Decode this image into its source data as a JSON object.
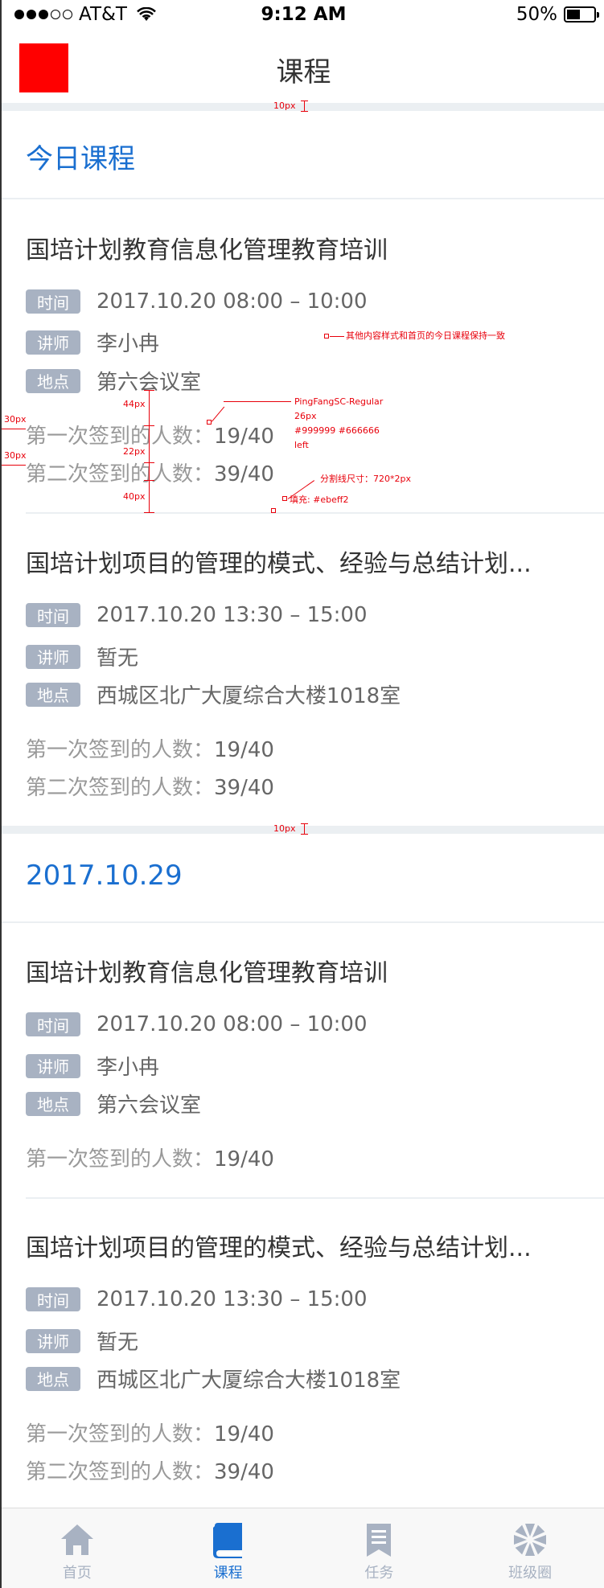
{
  "status_bar": {
    "carrier": "AT&T",
    "time": "9:12 AM",
    "battery": "50%",
    "battery_level": 0.5
  },
  "nav": {
    "title": "课程"
  },
  "sections": [
    {
      "title": "今日课程",
      "courses": [
        {
          "title": "国培计划教育信息化管理教育培训",
          "time_tag": "时间",
          "time": "2017.10.20 08:00 – 10:00",
          "teacher_tag": "讲师",
          "teacher": "李小冉",
          "location_tag": "地点",
          "location": "第六会议室",
          "counts": [
            {
              "label": "第一次签到的人数：",
              "value": "19/40"
            },
            {
              "label": "第二次签到的人数：",
              "value": "39/40"
            }
          ]
        },
        {
          "title": "国培计划项目的管理的模式、经验与总结计划...",
          "time_tag": "时间",
          "time": "2017.10.20 13:30 – 15:00",
          "teacher_tag": "讲师",
          "teacher": "暂无",
          "location_tag": "地点",
          "location": "西城区北广大厦综合大楼1018室",
          "counts": [
            {
              "label": "第一次签到的人数：",
              "value": "19/40"
            },
            {
              "label": "第二次签到的人数：",
              "value": "39/40"
            }
          ]
        }
      ]
    },
    {
      "title": "2017.10.29",
      "courses": [
        {
          "title": "国培计划教育信息化管理教育培训",
          "time_tag": "时间",
          "time": "2017.10.20 08:00 – 10:00",
          "teacher_tag": "讲师",
          "teacher": "李小冉",
          "location_tag": "地点",
          "location": "第六会议室",
          "counts": [
            {
              "label": "第一次签到的人数：",
              "value": "19/40"
            }
          ]
        },
        {
          "title": "国培计划项目的管理的模式、经验与总结计划...",
          "time_tag": "时间",
          "time": "2017.10.20 13:30 – 15:00",
          "teacher_tag": "讲师",
          "teacher": "暂无",
          "location_tag": "地点",
          "location": "西城区北广大厦综合大楼1018室",
          "counts": [
            {
              "label": "第一次签到的人数：",
              "value": "19/40"
            },
            {
              "label": "第二次签到的人数：",
              "value": "39/40"
            }
          ]
        }
      ]
    }
  ],
  "annotations": {
    "band_1": "10px",
    "band_2": "10px",
    "note_consistent": "其他内容样式和首页的今日课程保持一致",
    "gap_44": "44px",
    "gap_22": "22px",
    "gap_40": "40px",
    "left_30_a": "30px",
    "left_30_b": "30px",
    "font_name": "PingFangSC-Regular",
    "font_size": "26px",
    "font_colors": "#999999  #666666",
    "font_align": "left",
    "divider_size": "分割线尺寸：720*2px",
    "divider_fill": "填充: #ebeff2"
  },
  "tabs": [
    {
      "label": "首页",
      "icon": "home-icon",
      "active": false
    },
    {
      "label": "课程",
      "icon": "book-icon",
      "active": true
    },
    {
      "label": "任务",
      "icon": "bookmark-icon",
      "active": false
    },
    {
      "label": "班级圈",
      "icon": "pinwheel-icon",
      "active": false
    }
  ],
  "colors": {
    "accent": "#1a6fd0",
    "tag_bg": "#a8b2c2",
    "divider": "#ebeff2",
    "annotation": "#e8000b"
  }
}
